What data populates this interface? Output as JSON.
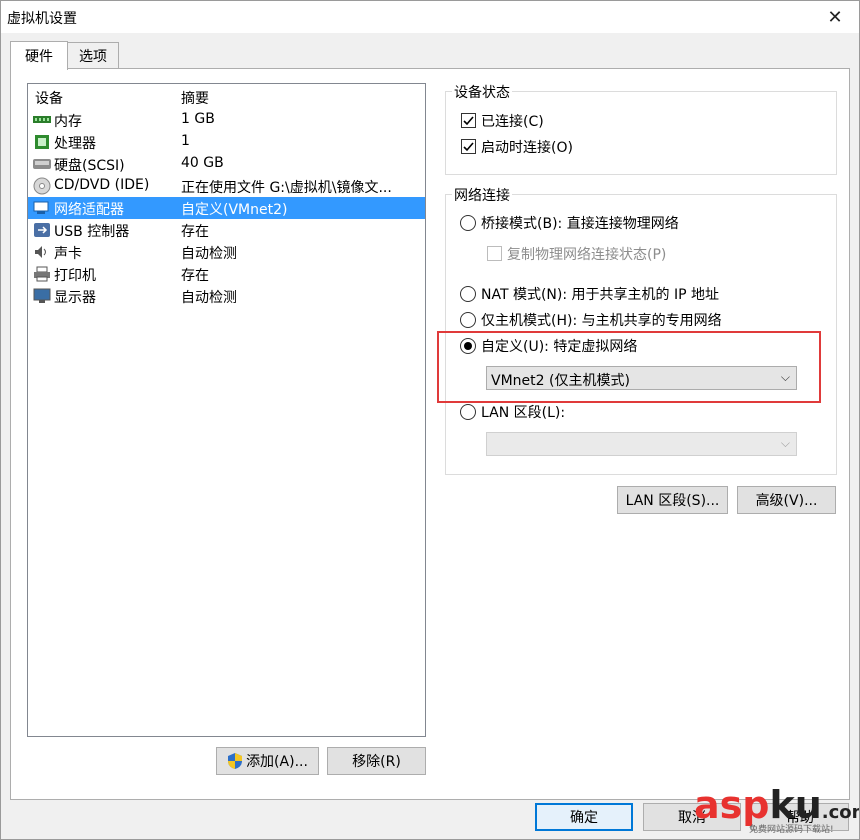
{
  "window": {
    "title": "虚拟机设置"
  },
  "tabs": [
    {
      "label": "硬件"
    },
    {
      "label": "选项"
    }
  ],
  "device_list": {
    "headers": {
      "device": "设备",
      "summary": "摘要"
    },
    "rows": [
      {
        "name": "内存",
        "summary": "1 GB",
        "icon": "memory-icon"
      },
      {
        "name": "处理器",
        "summary": "1",
        "icon": "processor-icon"
      },
      {
        "name": "硬盘(SCSI)",
        "summary": "40 GB",
        "icon": "harddisk-icon"
      },
      {
        "name": "CD/DVD (IDE)",
        "summary": "正在使用文件 G:\\虚拟机\\镜像文...",
        "icon": "cdrom-icon"
      },
      {
        "name": "网络适配器",
        "summary": "自定义(VMnet2)",
        "icon": "network-adapter-icon",
        "selected": true
      },
      {
        "name": "USB 控制器",
        "summary": "存在",
        "icon": "usb-icon"
      },
      {
        "name": "声卡",
        "summary": "自动检测",
        "icon": "sound-icon"
      },
      {
        "name": "打印机",
        "summary": "存在",
        "icon": "printer-icon"
      },
      {
        "name": "显示器",
        "summary": "自动检测",
        "icon": "display-icon"
      }
    ]
  },
  "buttons": {
    "add": "添加(A)...",
    "remove": "移除(R)",
    "lan_segment": "LAN 区段(S)...",
    "advanced": "高级(V)...",
    "ok": "确定",
    "cancel": "取消",
    "help": "帮助"
  },
  "device_status": {
    "title": "设备状态",
    "connected": {
      "label": "已连接(C)",
      "checked": true
    },
    "connect_on_start": {
      "label": "启动时连接(O)",
      "checked": true
    }
  },
  "network_connection": {
    "title": "网络连接",
    "bridged": "桥接模式(B): 直接连接物理网络",
    "replicate": "复制物理网络连接状态(P)",
    "nat": "NAT 模式(N): 用于共享主机的 IP 地址",
    "hostonly": "仅主机模式(H): 与主机共享的专用网络",
    "custom": "自定义(U): 特定虚拟网络",
    "custom_value": "VMnet2 (仅主机模式)",
    "lan": "LAN 区段(L):",
    "selected": "custom"
  },
  "watermark": {
    "brand_a": "asp",
    "brand_b": "ku",
    "brand_tld": ".com",
    "sub": "免费网站源码下载站!"
  }
}
